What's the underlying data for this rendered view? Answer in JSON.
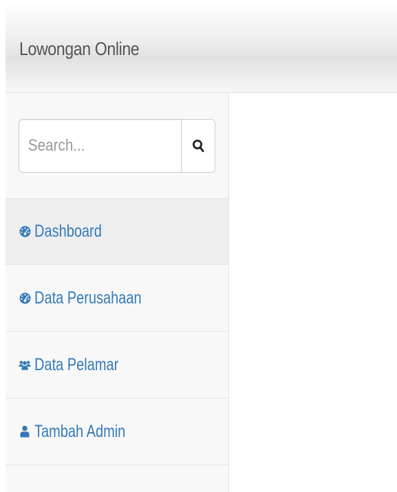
{
  "navbar": {
    "brand": "Lowongan Online"
  },
  "search": {
    "placeholder": "Search...",
    "button_icon": "search-icon"
  },
  "sidebar": {
    "items": [
      {
        "label": "Dashboard",
        "icon": "dashboard-icon",
        "active": true
      },
      {
        "label": "Data Perusahaan",
        "icon": "dashboard-icon",
        "active": false
      },
      {
        "label": "Data Pelamar",
        "icon": "users-icon",
        "active": false
      },
      {
        "label": "Tambah Admin",
        "icon": "user-icon",
        "active": false
      }
    ]
  },
  "colors": {
    "link": "#337ab7",
    "brand_text": "#555555",
    "sidebar_bg": "#f8f8f8",
    "active_bg": "#eeeeee"
  }
}
